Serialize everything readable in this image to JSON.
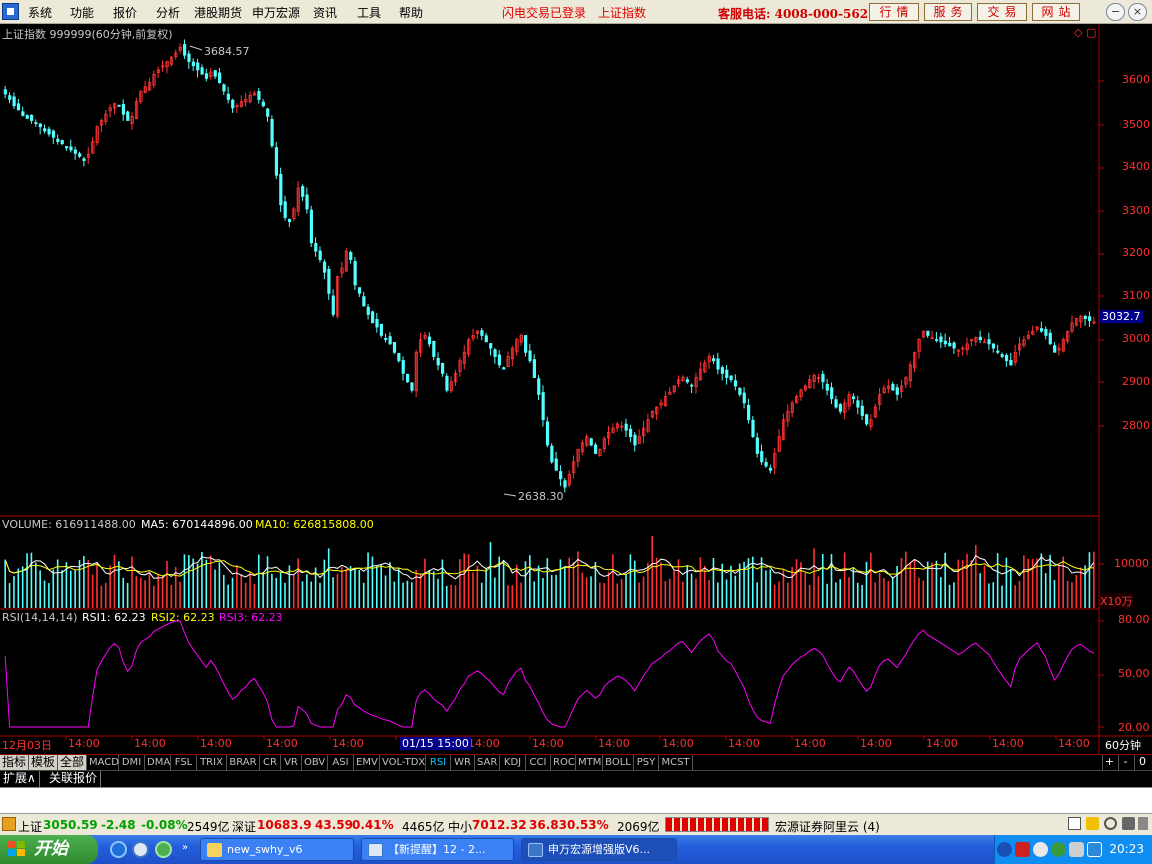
{
  "menubar": {
    "items": [
      "系统",
      "功能",
      "报价",
      "分析",
      "港股期货",
      "申万宏源",
      "资讯",
      "工具",
      "帮助"
    ],
    "status_login": "闪电交易已登录",
    "status_index": "上证指数",
    "hotline": "客服电话: 4008-000-562",
    "top_buttons": [
      "行情",
      "服务",
      "交易",
      "网站"
    ]
  },
  "chart_header": {
    "title": "上证指数 999999(60分钟,前复权)",
    "high_label": "3684.57",
    "low_label": "2638.30",
    "current_price": "3032.7"
  },
  "price_axis": {
    "ticks": [
      "3600",
      "3500",
      "3400",
      "3300",
      "3200",
      "3100",
      "3000",
      "2900",
      "2800"
    ]
  },
  "volume_header": {
    "label": "VOLUME: 616911488.00",
    "ma5": "MA5: 670144896.00",
    "ma10": "MA10: 626815808.00"
  },
  "volume_axis": {
    "tick": "10000",
    "unit": "X10万"
  },
  "rsi_header": {
    "label": "RSI(14,14,14)",
    "rsi1": "RSI1: 62.23",
    "rsi2": "RSI2: 62.23",
    "rsi3": "RSI3: 62.23"
  },
  "rsi_axis": {
    "ticks": [
      "80.00",
      "50.00",
      "20.00"
    ]
  },
  "time_axis": {
    "labels": [
      "12月03日",
      "14:00",
      "14:00",
      "14:00",
      "14:00",
      "14:00",
      "14:00",
      "14:00",
      "14:00",
      "14:00",
      "14:00",
      "14:00",
      "14:00",
      "14:00",
      "14:00",
      "14:00",
      "14:00",
      "14:00"
    ],
    "cursor_label": "01/15 15:00",
    "period": "60分钟"
  },
  "indicator_tabs": [
    "指标",
    "模板",
    "全部",
    "MACD",
    "DMI",
    "DMA",
    "FSL",
    "TRIX",
    "BRAR",
    "CR",
    "VR",
    "OBV",
    "ASI",
    "EMV",
    "VOL-TDX",
    "RSI",
    "WR",
    "SAR",
    "KDJ",
    "CCI",
    "ROC",
    "MTM",
    "BOLL",
    "PSY",
    "MCST"
  ],
  "indicator_active": "RSI",
  "zoom_buttons": [
    "+",
    "-",
    "0"
  ],
  "row_tabs": [
    "扩展∧",
    "关联报价"
  ],
  "statusbar": {
    "sh_label": "上证",
    "sh_value": "3050.59",
    "sh_change": "-2.48",
    "sh_pct": "-0.08%",
    "sh_amount": "2549亿",
    "sz_label": "深证",
    "sz_value": "10683.9",
    "sz_change": "43.59",
    "sz_pct": "0.41%",
    "sz_amount": "4465亿",
    "zx_label": "中小",
    "zx_value": "7012.32",
    "zx_change": "36.83",
    "zx_pct": "0.53%",
    "zx_amount": "2069亿",
    "broker": "宏源证券阿里云 (4)"
  },
  "taskbar": {
    "start": "开始",
    "tasks": [
      "new_swhy_v6",
      "【新提醒】12 - 2...",
      "申万宏源增强版V6..."
    ],
    "clock": "20:23"
  },
  "colors": {
    "up": "#ff3232",
    "down": "#54ffff",
    "axis": "#b00000",
    "rsi": "#ff00ff",
    "ma5": "#ffffff",
    "ma10": "#ffff00"
  },
  "chart_data": {
    "type": "candlestick",
    "close": [
      3573,
      3560,
      3545,
      3535,
      3522,
      3515,
      3510,
      3505,
      3495,
      3485,
      3478,
      3470,
      3460,
      3455,
      3445,
      3440,
      3432,
      3425,
      3415,
      3430,
      3460,
      3495,
      3510,
      3525,
      3540,
      3550,
      3545,
      3525,
      3510,
      3520,
      3555,
      3580,
      3590,
      3600,
      3620,
      3630,
      3640,
      3650,
      3660,
      3670,
      3684,
      3665,
      3650,
      3640,
      3630,
      3620,
      3610,
      3625,
      3615,
      3600,
      3580,
      3560,
      3540,
      3545,
      3555,
      3560,
      3570,
      3575,
      3560,
      3545,
      3520,
      3450,
      3380,
      3310,
      3280,
      3270,
      3300,
      3350,
      3330,
      3300,
      3220,
      3200,
      3180,
      3150,
      3100,
      3050,
      3140,
      3160,
      3200,
      3180,
      3120,
      3100,
      3070,
      3050,
      3030,
      3020,
      3000,
      2990,
      2980,
      2960,
      2940,
      2910,
      2890,
      2870,
      2960,
      2990,
      3000,
      2980,
      2950,
      2930,
      2910,
      2870,
      2890,
      2910,
      2940,
      2960,
      2990,
      3000,
      3010,
      3000,
      2985,
      2970,
      2950,
      2930,
      2920,
      2950,
      2970,
      2990,
      3000,
      2960,
      2940,
      2900,
      2860,
      2800,
      2740,
      2700,
      2680,
      2660,
      2640,
      2670,
      2700,
      2730,
      2745,
      2760,
      2740,
      2720,
      2730,
      2755,
      2770,
      2780,
      2790,
      2785,
      2775,
      2760,
      2740,
      2760,
      2780,
      2800,
      2820,
      2830,
      2840,
      2855,
      2865,
      2880,
      2895,
      2900,
      2890,
      2880,
      2900,
      2920,
      2935,
      2950,
      2940,
      2920,
      2910,
      2900,
      2895,
      2880,
      2860,
      2840,
      2800,
      2760,
      2720,
      2700,
      2690,
      2680,
      2720,
      2760,
      2800,
      2820,
      2840,
      2855,
      2870,
      2880,
      2895,
      2905,
      2900,
      2890,
      2870,
      2850,
      2830,
      2820,
      2840,
      2860,
      2850,
      2830,
      2810,
      2790,
      2800,
      2830,
      2860,
      2875,
      2880,
      2870,
      2860,
      2880,
      2900,
      2930,
      2960,
      2990,
      3010,
      3000,
      2995,
      2990,
      2985,
      2980,
      2975,
      2970,
      2965,
      2970,
      2980,
      2990,
      2995,
      2990,
      2985,
      2980,
      2970,
      2960,
      2950,
      2940,
      2930,
      2960,
      2980,
      2990,
      3000,
      3010,
      3020,
      3010,
      3000,
      2980,
      2960,
      2970,
      2990,
      3010,
      3030,
      3040,
      3045,
      3040,
      3035,
      3032
    ]
  }
}
